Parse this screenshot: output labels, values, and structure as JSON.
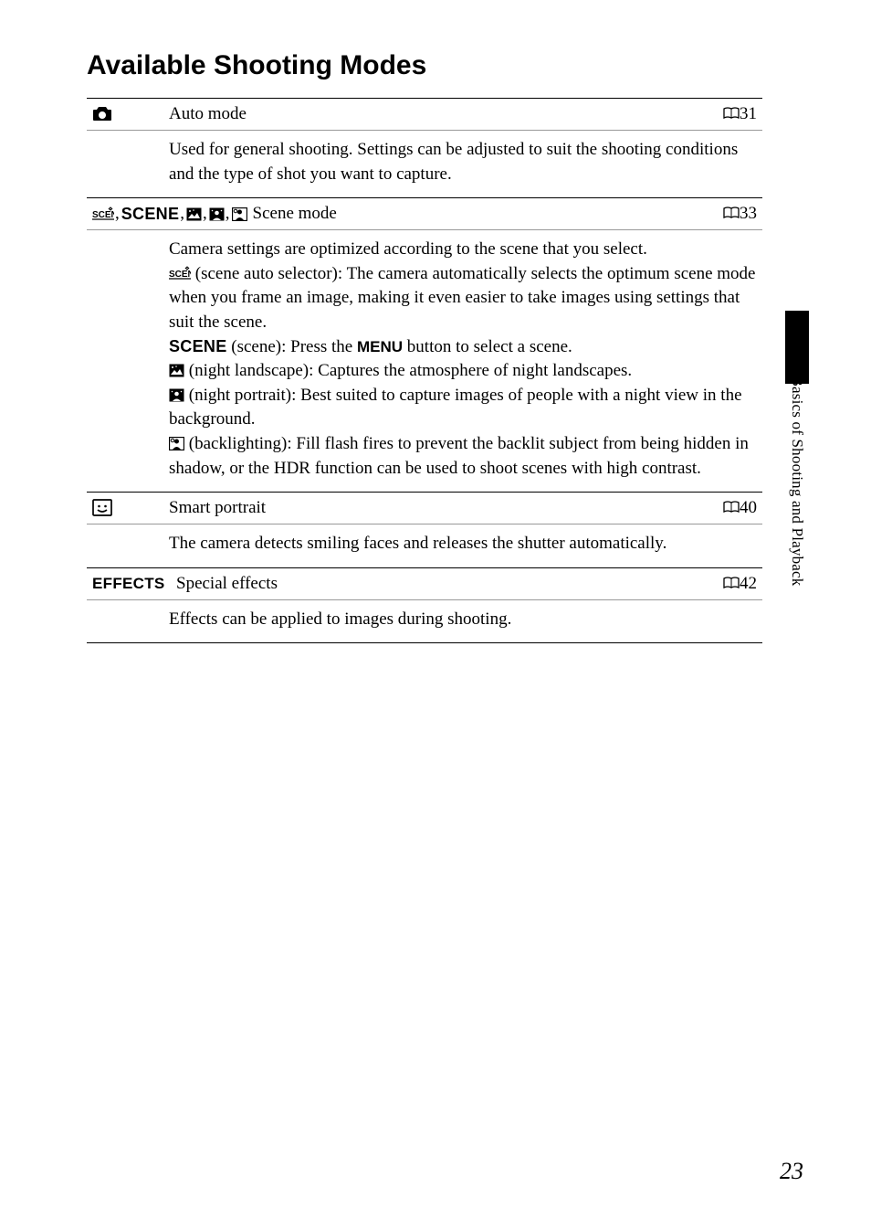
{
  "title": "Available Shooting Modes",
  "sideText": "The Basics of Shooting and Playback",
  "pageNumber": "23",
  "modes": [
    {
      "icon": "camera",
      "name": "Auto mode",
      "ref": "31",
      "body": {
        "intro": "Used for general shooting. Settings can be adjusted to suit the shooting conditions and the type of shot you want to capture."
      }
    },
    {
      "icon": "scene-group",
      "name": "Scene mode",
      "ref": "33",
      "body": {
        "line1": "Camera settings are optimized according to the scene that you select.",
        "sceneAuto": " (scene auto selector): The camera automatically selects the optimum scene mode when you frame an image, making it even easier to take images using settings that suit the scene.",
        "sceneWord": "SCENE",
        "scenePress": " (scene): Press the ",
        "menuWord": "MENU",
        "sceneSelect": " button to select a scene.",
        "nightLandscape": " (night landscape): Captures the atmosphere of night landscapes.",
        "nightPortrait": " (night portrait): Best suited to capture images of people with a night view in the background.",
        "backlighting": " (backlighting): Fill flash fires to prevent the backlit subject from being hidden in shadow, or the HDR function can be used to shoot scenes with high contrast."
      }
    },
    {
      "icon": "smart-portrait",
      "name": "Smart portrait",
      "ref": "40",
      "body": {
        "intro": "The camera detects smiling faces and releases the shutter automatically."
      }
    },
    {
      "icon": "effects",
      "name": "Special effects",
      "ref": "42",
      "body": {
        "intro": "Effects can be applied to images during shooting."
      }
    }
  ]
}
